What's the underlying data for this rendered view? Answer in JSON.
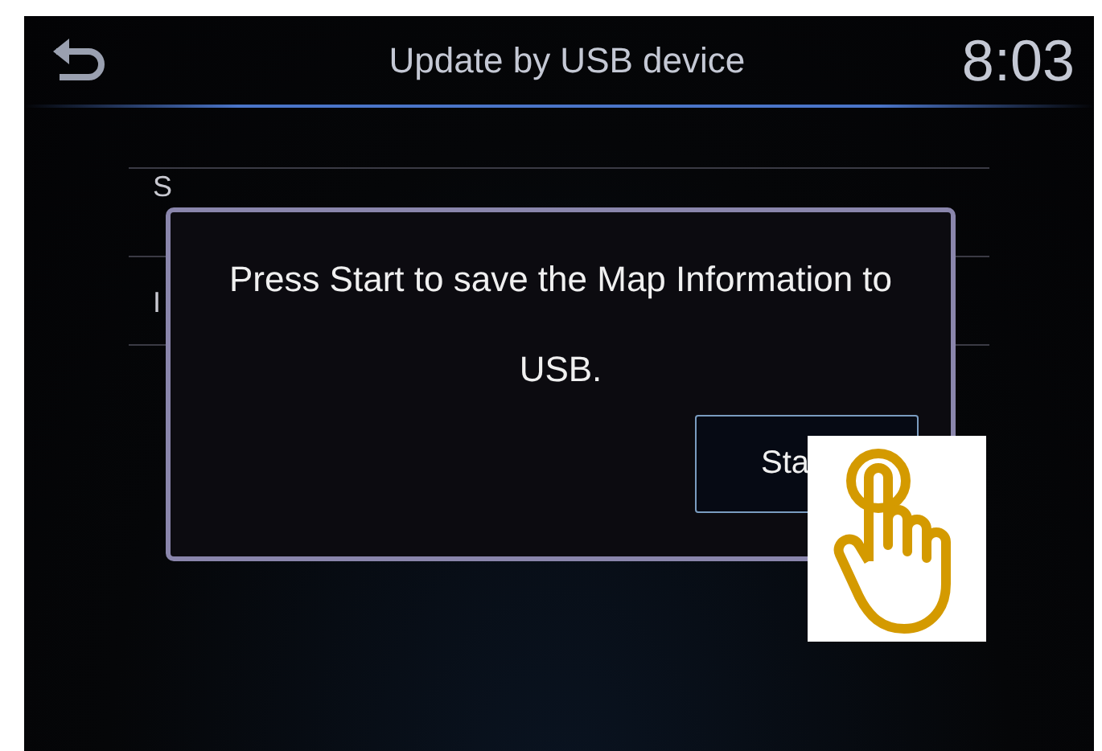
{
  "header": {
    "title": "Update by USB device",
    "clock": "8:03"
  },
  "list": {
    "items": [
      {
        "label": "S"
      },
      {
        "label": "I"
      }
    ]
  },
  "dialog": {
    "message": "Press Start to save the Map Information to USB.",
    "buttons": [
      {
        "label": "Sta"
      }
    ]
  }
}
